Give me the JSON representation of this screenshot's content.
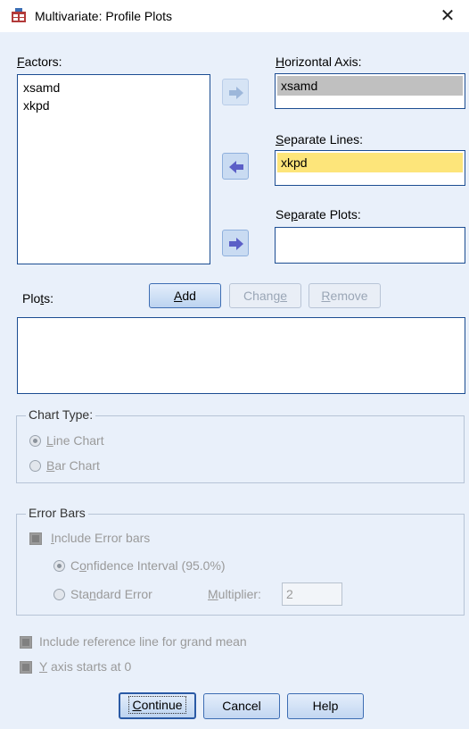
{
  "window": {
    "title": "Multivariate: Profile Plots",
    "close_glyph": "✕"
  },
  "factors": {
    "label_u": "F",
    "label_rest": "actors:",
    "items": [
      "xsamd",
      "xkpd"
    ]
  },
  "horizontal_axis": {
    "label_u": "H",
    "label_rest": "orizontal Axis:",
    "value": "xsamd"
  },
  "separate_lines": {
    "label_u": "S",
    "label_rest": "eparate Lines:",
    "value": "xkpd"
  },
  "separate_plots": {
    "label_pre": "Se",
    "label_u": "p",
    "label_rest": "arate Plots:",
    "value": ""
  },
  "plots": {
    "label_pre": "Plo",
    "label_u": "t",
    "label_rest": "s:"
  },
  "buttons": {
    "add_u": "A",
    "add_rest": "dd",
    "change_pre": "Chang",
    "change_u": "e",
    "change_rest": "",
    "remove_u": "R",
    "remove_rest": "emove",
    "continue_u": "C",
    "continue_rest": "ontinue",
    "cancel": "Cancel",
    "help": "Help"
  },
  "chart_type": {
    "legend": "Chart Type:",
    "line_u": "L",
    "line_rest": "ine Chart",
    "bar_u": "B",
    "bar_rest": "ar Chart",
    "selected": "line"
  },
  "error_bars": {
    "legend": "Error Bars",
    "include_u": "I",
    "include_rest": "nclude Error bars",
    "ci_u": "o",
    "ci_pre": "C",
    "ci_rest": "nfidence Interval (95.0%)",
    "se_pre": "Sta",
    "se_u": "n",
    "se_rest": "dard Error",
    "multiplier_u": "M",
    "multiplier_rest": "ultiplier:",
    "multiplier_value": "2"
  },
  "options": {
    "grand_mean_pre": "Include reference line for ",
    "grand_mean_u": "g",
    "grand_mean_rest": "rand mean",
    "yaxis_u": "Y",
    "yaxis_rest": " axis starts at 0"
  },
  "colors": {
    "client_bg": "#e9f0fa",
    "selected_fill": "#fde57a",
    "accent_border": "#1c4d92"
  }
}
